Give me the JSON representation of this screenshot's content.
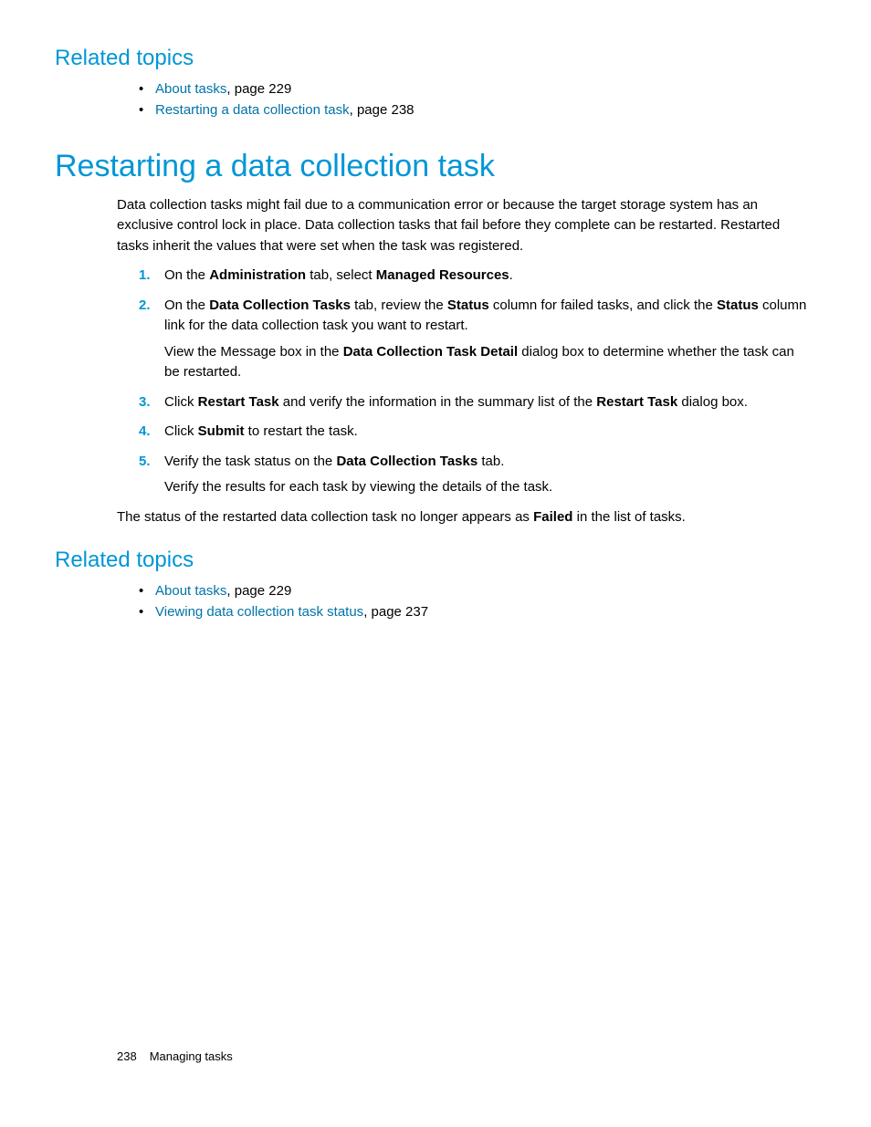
{
  "related1": {
    "heading": "Related topics",
    "items": [
      {
        "link": "About tasks",
        "suffix": ", page 229"
      },
      {
        "link": "Restarting a data collection task",
        "suffix": ", page 238"
      }
    ]
  },
  "main": {
    "heading": "Restarting a data collection task",
    "intro": "Data collection tasks might fail due to a communication error or because the target storage system has an exclusive control lock in place. Data collection tasks that fail before they complete can be restarted. Restarted tasks inherit the values that were set when the task was registered.",
    "steps": {
      "s1_a": "On the ",
      "s1_b": "Administration",
      "s1_c": " tab, select ",
      "s1_d": "Managed Resources",
      "s1_e": ".",
      "s2_a": "On the ",
      "s2_b": "Data Collection Tasks",
      "s2_c": " tab, review the ",
      "s2_d": "Status",
      "s2_e": " column for failed tasks, and click the ",
      "s2_f": "Status",
      "s2_g": " column link for the data collection task you want to restart.",
      "s2_sub_a": "View the Message box in the ",
      "s2_sub_b": "Data Collection Task Detail",
      "s2_sub_c": " dialog box to determine whether the task can be restarted.",
      "s3_a": "Click ",
      "s3_b": "Restart Task",
      "s3_c": " and verify the information in the summary list of the ",
      "s3_d": "Restart Task",
      "s3_e": " dialog box.",
      "s4_a": "Click ",
      "s4_b": "Submit",
      "s4_c": " to restart the task.",
      "s5_a": "Verify the task status on the ",
      "s5_b": "Data Collection Tasks",
      "s5_c": " tab.",
      "s5_sub": "Verify the results for each task by viewing the details of the task."
    },
    "closing_a": "The status of the restarted data collection task no longer appears as ",
    "closing_b": "Failed",
    "closing_c": " in the list of tasks."
  },
  "related2": {
    "heading": "Related topics",
    "items": [
      {
        "link": "About tasks",
        "suffix": ", page 229"
      },
      {
        "link": "Viewing data collection task status",
        "suffix": ", page 237"
      }
    ]
  },
  "footer": {
    "page": "238",
    "section": "Managing tasks"
  }
}
